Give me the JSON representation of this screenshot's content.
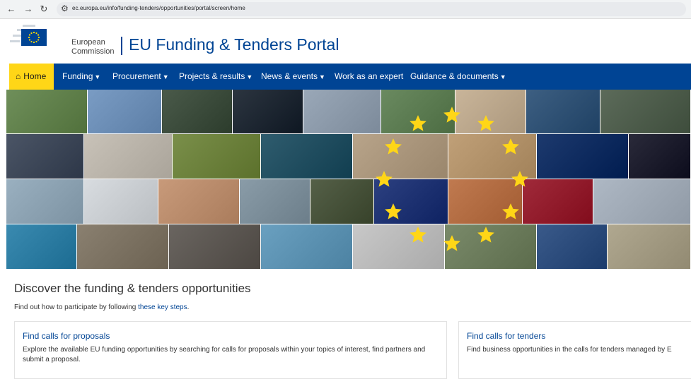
{
  "browser": {
    "url": "ec.europa.eu/info/funding-tenders/opportunities/portal/screen/home",
    "back_icon": "arrow-left-icon",
    "forward_icon": "arrow-right-icon",
    "reload_icon": "reload-icon",
    "site_settings_icon": "tune-icon"
  },
  "header": {
    "org_line1": "European",
    "org_line2": "Commission",
    "portal_title": "EU Funding & Tenders Portal",
    "logo_icon": "eu-flag-logo"
  },
  "menu": {
    "items": [
      {
        "label": "Home",
        "dropdown": false
      },
      {
        "label": "Funding",
        "dropdown": true
      },
      {
        "label": "Procurement",
        "dropdown": true
      },
      {
        "label": "Projects & results",
        "dropdown": true
      },
      {
        "label": "News & events",
        "dropdown": true
      },
      {
        "label": "Work as an expert",
        "dropdown": false
      },
      {
        "label": "Guidance & documents",
        "dropdown": true
      }
    ]
  },
  "content": {
    "heading": "Discover the funding & tenders opportunities",
    "intro_prefix": "Find out how to participate by following ",
    "intro_link": "these key steps",
    "intro_suffix": ".",
    "cards": [
      {
        "title": "Find calls for proposals",
        "description": "Explore the available EU funding opportunities by searching for calls for proposals within your topics of interest, find partners and submit a proposal."
      },
      {
        "title": "Find calls for tenders",
        "description": "Find business opportunities in the calls for tenders managed by E"
      }
    ]
  },
  "colors": {
    "brand_blue": "#004494",
    "home_yellow": "#ffd617",
    "star_yellow": "#ffd617"
  }
}
